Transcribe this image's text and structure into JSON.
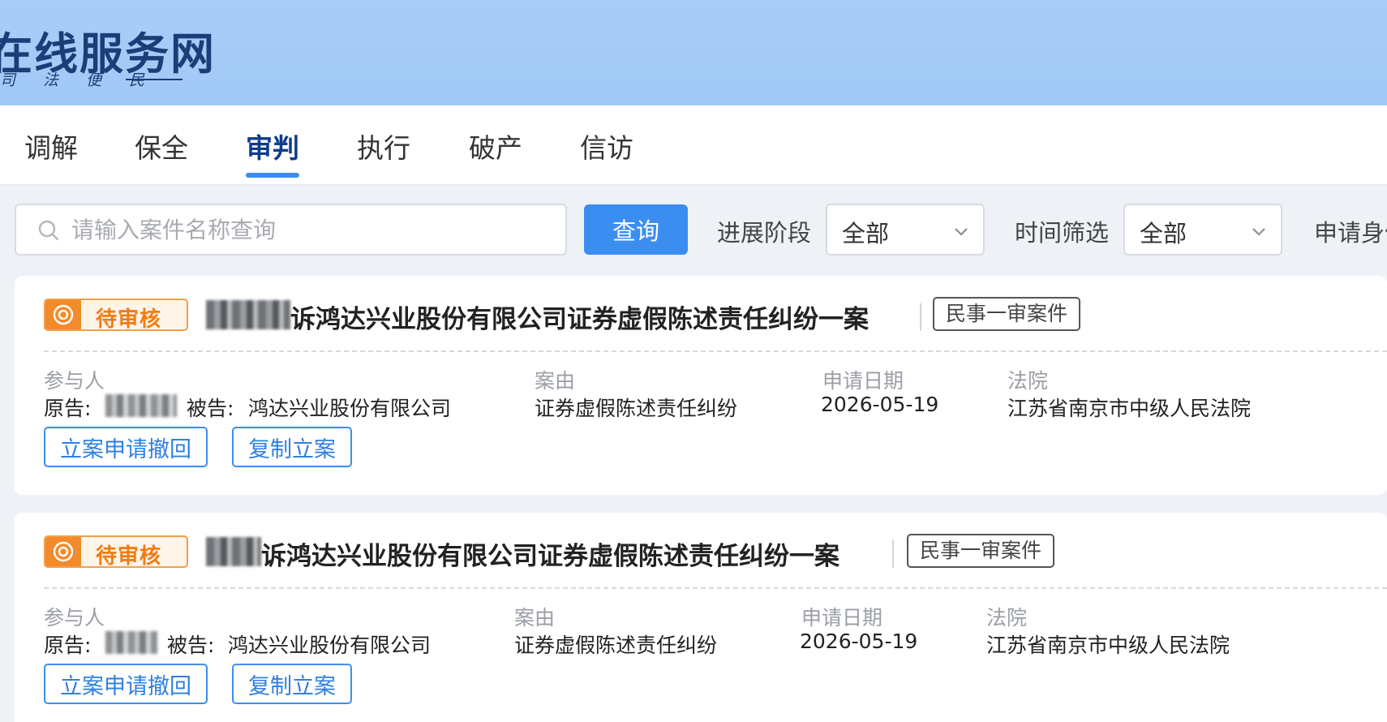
{
  "header": {
    "site_title": "在线服务网",
    "slogan": "司 法 便 民"
  },
  "nav": {
    "tabs": [
      {
        "label": "调解",
        "active": false
      },
      {
        "label": "保全",
        "active": false
      },
      {
        "label": "审判",
        "active": true
      },
      {
        "label": "执行",
        "active": false
      },
      {
        "label": "破产",
        "active": false
      },
      {
        "label": "信访",
        "active": false
      }
    ]
  },
  "filters": {
    "search_placeholder": "请输入案件名称查询",
    "query_label": "查询",
    "progress_label": "进展阶段",
    "progress_value": "全部",
    "time_label": "时间筛选",
    "time_value": "全部",
    "identity_label": "申请身份"
  },
  "labels": {
    "participants": "参与人",
    "cause": "案由",
    "apply_date": "申请日期",
    "court": "法院",
    "plaintiff": "原告:",
    "defendant": "被告:"
  },
  "cases": [
    {
      "status": "待审核",
      "title": "诉鸿达兴业股份有限公司证券虚假陈述责任纠纷一案",
      "case_type": "民事一审案件",
      "defendant": "鸿达兴业股份有限公司",
      "cause": "证券虚假陈述责任纠纷",
      "apply_date": "2026-05-19",
      "court": "江苏省南京市中级人民法院",
      "withdraw_label": "立案申请撤回",
      "copy_label": "复制立案"
    },
    {
      "status": "待审核",
      "title": "诉鸿达兴业股份有限公司证券虚假陈述责任纠纷一案",
      "case_type": "民事一审案件",
      "defendant": "鸿达兴业股份有限公司",
      "cause": "证券虚假陈述责任纠纷",
      "apply_date": "2026-05-19",
      "court": "江苏省南京市中级人民法院",
      "withdraw_label": "立案申请撤回",
      "copy_label": "复制立案"
    }
  ],
  "colors": {
    "banner": "#a1c8f5",
    "accent": "#3b8ef0",
    "pending": "#f28b2c"
  }
}
